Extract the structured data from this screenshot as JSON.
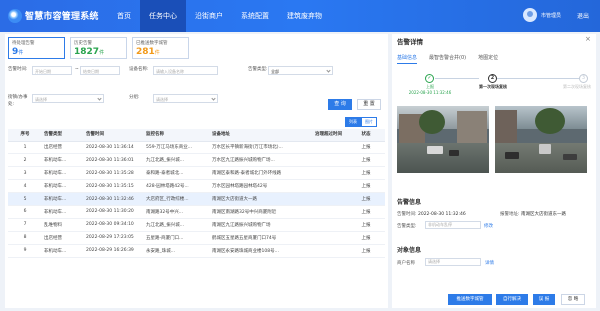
{
  "header": {
    "app_title": "智慧市容管理系统",
    "nav": [
      "首页",
      "任务中心",
      "沿街商户",
      "系统配置",
      "建筑废弃物"
    ],
    "active_nav": 1,
    "username": "市管理员",
    "logout": "退出"
  },
  "stats": [
    {
      "label": "待处理告警",
      "value": "9",
      "unit": "件"
    },
    {
      "label": "历史告警",
      "value": "1827",
      "unit": "件"
    },
    {
      "label": "已推送数字城管",
      "value": "281",
      "unit": "件"
    }
  ],
  "filters": {
    "alarm_time_label": "告警时间:",
    "start_placeholder": "开始日期",
    "range_sep": "~",
    "end_placeholder": "结束日期",
    "device_label": "设备名称:",
    "device_placeholder": "请输入设备名称",
    "type_label": "告警类型:",
    "type_value": "全部",
    "street_label": "街镇/办事处:",
    "street_placeholder": "请选择",
    "group_label": "分组:",
    "group_placeholder": "请选择",
    "query": "查 询",
    "reset": "重 置",
    "view_list": "列表",
    "view_image": "图片"
  },
  "table": {
    "columns": [
      "序号",
      "告警类型",
      "告警时间",
      "监控名称",
      "设备地址",
      "治理超过时间",
      "状态"
    ],
    "rows": [
      [
        "1",
        "出店经营",
        "2022-08-30 11:36:14",
        "559-万江马场东商业...",
        "万水区长平镇新海街(万江市场北)...",
        "",
        "上报"
      ],
      [
        "2",
        "非机动车...",
        "2022-08-30 11:36:01",
        "九江北路_振兴城...",
        "万水区九江路振兴城购物广场...",
        "",
        "上报"
      ],
      [
        "3",
        "非机动车...",
        "2022-08-30 11:35:28",
        "泰和路-泰者城北...",
        "南湖区泰和路-泰者城北门外环线路",
        "",
        "上报"
      ],
      [
        "4",
        "非机动车...",
        "2022-08-30 11:35:15",
        "428-园林塔路42号...",
        "万水区园林塔路园林塔42号",
        "",
        "上报"
      ],
      [
        "5",
        "非机动车...",
        "2022-08-30 11:32:46",
        "大店府区_行政综楼...",
        "南湖区大店街道大一路",
        "",
        "上报"
      ],
      [
        "6",
        "非机动车...",
        "2022-08-30 11:30:20",
        "南湖路32号中兴...",
        "南湖区南湖路32号中兴商厦附近",
        "",
        "上报"
      ],
      [
        "7",
        "乱堆物料",
        "2022-08-30 09:34:10",
        "九江北路_振兴城...",
        "南湖区九江路振兴城购物广场",
        "",
        "上报"
      ],
      [
        "8",
        "出店经营",
        "2022-08-29 17:23:05",
        "五星路-商厦门口...",
        "鹤城区五星路五星商厦门口74号",
        "",
        "上报"
      ],
      [
        "9",
        "非机动车...",
        "2022-08-29 16:26:39",
        "永安路_珠城...",
        "南湖区永安路珠城商业楼108号...",
        "",
        "上报"
      ]
    ],
    "selected_row": 4
  },
  "detail": {
    "title": "告警详情",
    "close": "×",
    "tabs": [
      "基础信息",
      "最智告警合并(0)",
      "地图定位"
    ],
    "active_tab": 0,
    "steps": [
      {
        "num": "✓",
        "label": "上报",
        "time": "2022-08-30 11:32:46"
      },
      {
        "num": "2",
        "label": "第一次现场复核",
        "time": ""
      },
      {
        "num": "3",
        "label": "第二次现场复核",
        "time": ""
      }
    ],
    "alarm_info_title": "告警信息",
    "alarm_time_label": "告警时间:",
    "alarm_time_value": "2022-08-30 11:32:46",
    "location_label": "报警地址:",
    "location_value": "南湖区大店街道东一路",
    "alarm_type_label": "告警类型:",
    "alarm_type_value": "非机动车乱停",
    "modify_link": "修改",
    "object_title": "对象信息",
    "merchant_label": "商户名称",
    "merchant_placeholder": "请选择",
    "detail_link": "详情",
    "buttons": [
      "推送数字城管",
      "自行解决",
      "误 报",
      "忽 略"
    ]
  }
}
